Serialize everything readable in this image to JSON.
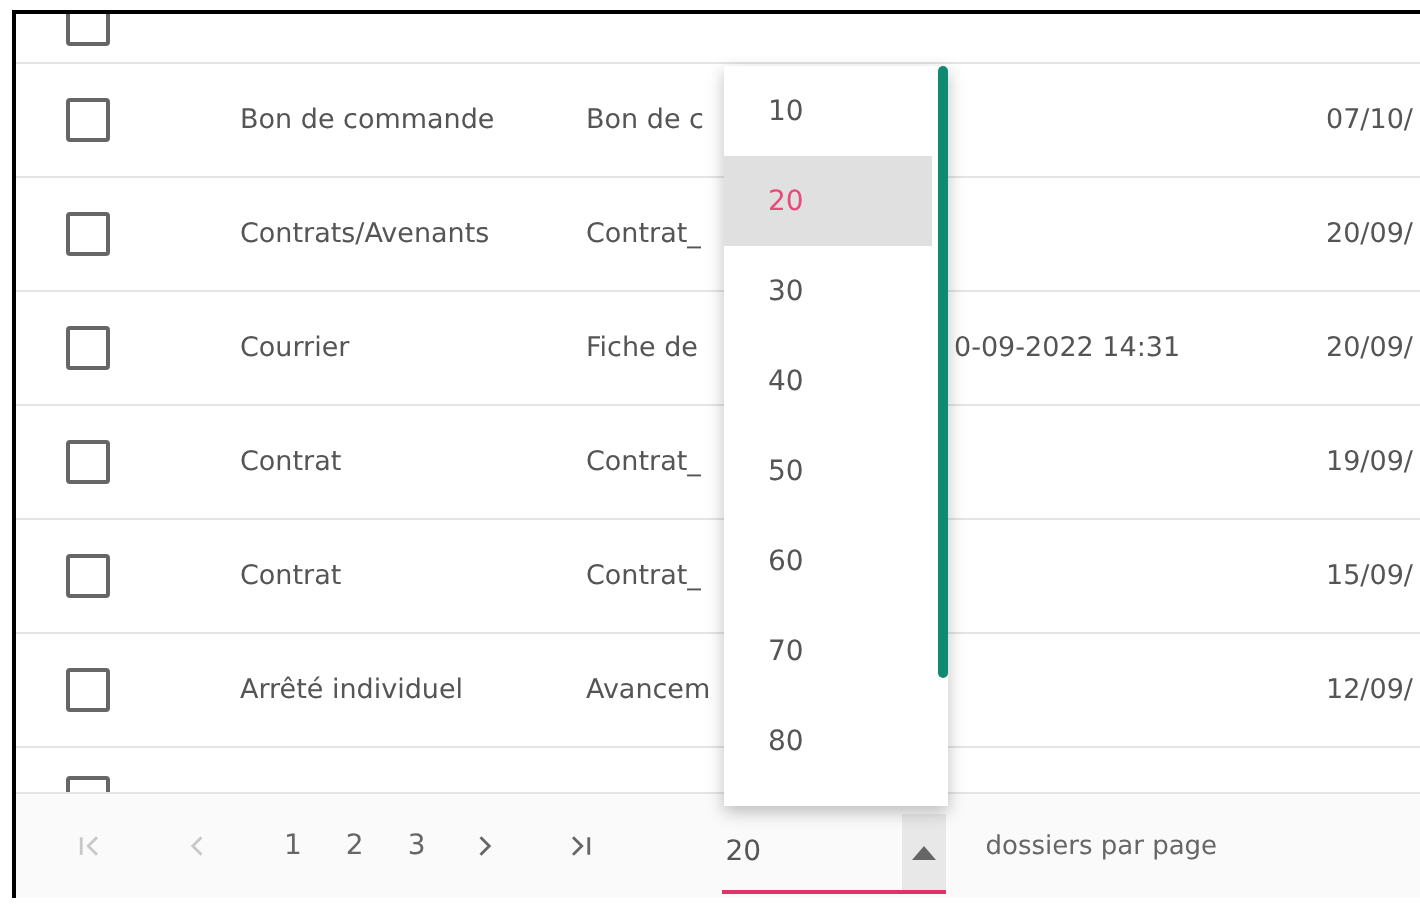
{
  "table": {
    "rows": [
      {
        "kind": "cut_top",
        "checked": false
      },
      {
        "kind": "full",
        "checked": false,
        "type": "Bon de commande",
        "name": "Bon de c",
        "modified": "07/10/"
      },
      {
        "kind": "full",
        "checked": false,
        "type": "Contrats/Avenants",
        "name": "Contrat_",
        "modified": "20/09/"
      },
      {
        "kind": "full",
        "checked": false,
        "type": "Courrier",
        "name": "Fiche de",
        "date": "0-09-2022 14:31",
        "modified": "20/09/"
      },
      {
        "kind": "full",
        "checked": false,
        "type": "Contrat",
        "name": "Contrat_",
        "modified": "19/09/"
      },
      {
        "kind": "full",
        "checked": false,
        "type": "Contrat",
        "name": "Contrat_",
        "modified": "15/09/"
      },
      {
        "kind": "full",
        "checked": false,
        "type": "Arrêté individuel",
        "name": "Avancem",
        "modified": "12/09/"
      },
      {
        "kind": "cut_bottom",
        "checked": false
      }
    ]
  },
  "pagination": {
    "controls": [
      {
        "kind": "first",
        "disabled": true
      },
      {
        "kind": "prev",
        "disabled": true
      },
      {
        "kind": "page",
        "label": "1"
      },
      {
        "kind": "page",
        "label": "2"
      },
      {
        "kind": "page",
        "label": "3"
      },
      {
        "kind": "next",
        "disabled": false
      },
      {
        "kind": "last",
        "disabled": false
      }
    ],
    "page_size": {
      "value": "20",
      "expanded": true,
      "options": [
        {
          "label": "10",
          "selected": false
        },
        {
          "label": "20",
          "selected": true
        },
        {
          "label": "30",
          "selected": false
        },
        {
          "label": "40",
          "selected": false
        },
        {
          "label": "50",
          "selected": false
        },
        {
          "label": "60",
          "selected": false
        },
        {
          "label": "70",
          "selected": false
        },
        {
          "label": "80",
          "selected": false
        }
      ]
    },
    "page_size_label": "dossiers par page"
  }
}
